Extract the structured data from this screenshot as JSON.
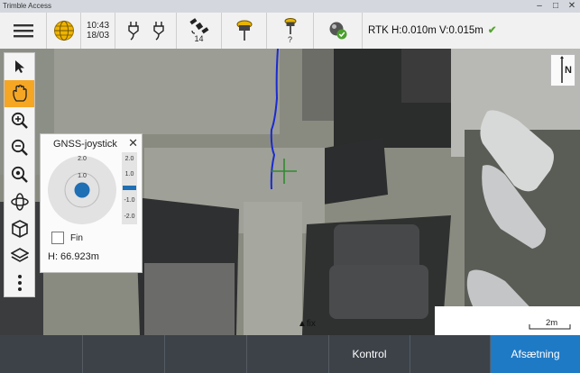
{
  "window": {
    "title": "Trimble Access"
  },
  "toolbar": {
    "time": "10:43",
    "date": "18/03",
    "satellites_count": "14",
    "receiver_unknown": "?",
    "rtk_status": "RTK H:0.010m V:0.015m"
  },
  "map": {
    "fix_label": "fix",
    "north_label": "N",
    "scale_label": "2m"
  },
  "joystick": {
    "title": "GNSS-joystick",
    "outer_ring_label": "2.0",
    "inner_ring_label": "1.0",
    "vertical_ticks": [
      "2.0",
      "1.0",
      "-1.0",
      "-2.0"
    ],
    "fine_label": "Fin",
    "height_label": "H: 66.923m"
  },
  "bottom": {
    "buttons": [
      "",
      "",
      "",
      "",
      "Kontrol",
      "",
      "Afsætning"
    ]
  },
  "colors": {
    "accent": "#1f7ac6",
    "active_tool": "#f5a623",
    "track": "#1a2bd0",
    "cursor": "#2f8a2f"
  }
}
